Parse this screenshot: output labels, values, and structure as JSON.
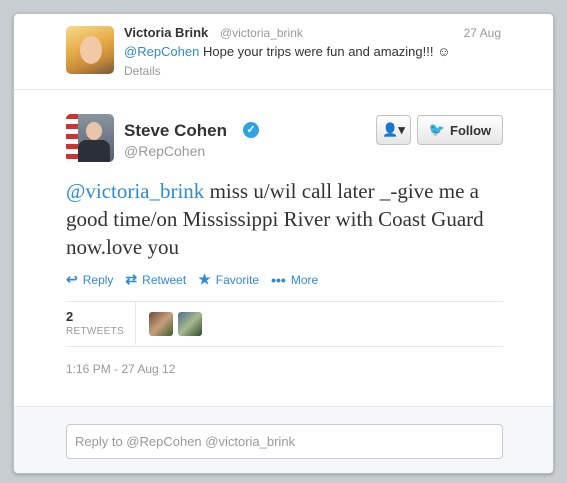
{
  "parent_tweet": {
    "name": "Victoria Brink",
    "handle": "@victoria_brink",
    "time": "27 Aug",
    "mention": "@RepCohen",
    "text": " Hope your trips were fun and amazing!!! ☺",
    "details_label": "Details"
  },
  "tweet": {
    "name": "Steve Cohen",
    "handle": "@RepCohen",
    "mention": "@victoria_brink",
    "text": " miss u/wil call later _-give me a good time/on Mississippi River with Coast Guard now.love you",
    "timestamp": "1:16 PM - 27 Aug 12"
  },
  "buttons": {
    "user_menu_icon": "👤▾",
    "follow_label": "Follow"
  },
  "actions": {
    "reply": "Reply",
    "retweet": "Retweet",
    "favorite": "Favorite",
    "more": "More"
  },
  "stats": {
    "retweet_count": "2",
    "retweet_label": "RETWEETS"
  },
  "reply_box": {
    "text": "Reply to @RepCohen @victoria_brink"
  },
  "colors": {
    "link": "#2f8bd2",
    "background": "#c7cdd1"
  }
}
